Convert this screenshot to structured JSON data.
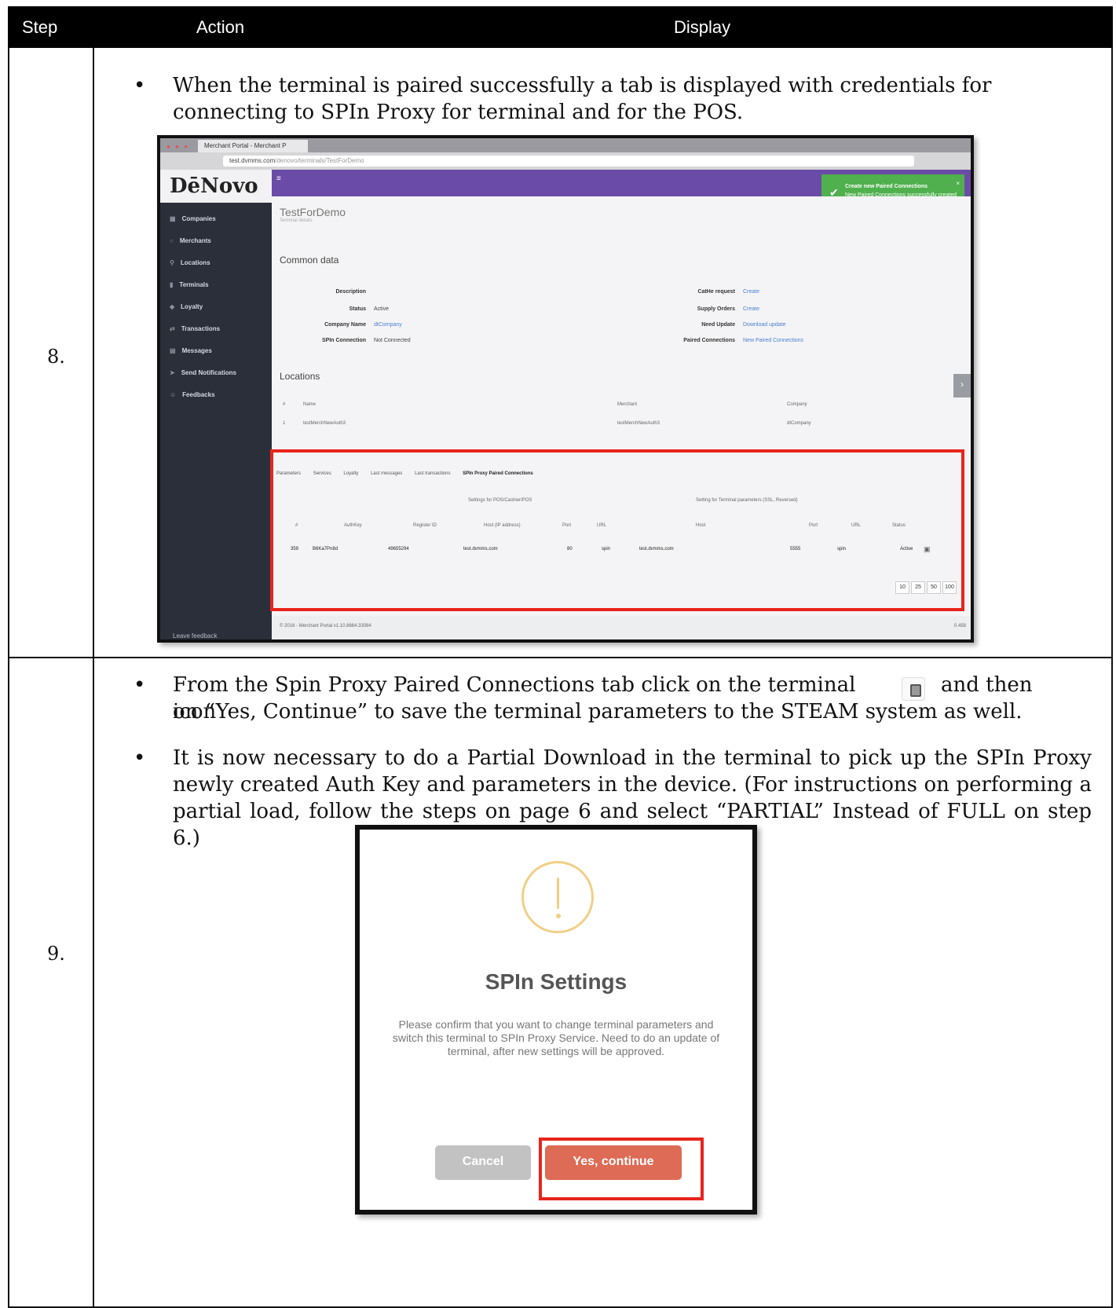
{
  "header": {
    "step": "Step",
    "action": "Action",
    "display": "Display"
  },
  "rows": [
    {
      "step": "8.",
      "bullets": [
        "When the terminal is paired successfully a tab is displayed with credentials for connecting to SPIn Proxy for terminal and for the POS."
      ]
    },
    {
      "step": "9.",
      "bullets": [
        "From the Spin Proxy Paired Connections tab click on the terminal icon",
        "and then on “Yes, Continue” to save the terminal parameters to the STEAM system as well.",
        "It is now necessary to do a Partial Download in the terminal to pick up the SPIn Proxy newly created Auth Key and parameters in the device. (For instructions on performing a partial load, follow the steps on page 6 and select “PARTIAL” Instead of FULL on step 6.)"
      ]
    }
  ],
  "screenshot": {
    "browser_tab": "Merchant Portal - Merchant P",
    "url_host": "test.dvmms.com",
    "url_path": "/denovo/terminals/TestForDemo",
    "logo": "DēNovo",
    "sidebar": [
      "Companies",
      "Merchants",
      "Locations",
      "Terminals",
      "Loyalty",
      "Transactions",
      "Messages",
      "Send Notifications",
      "Feedbacks"
    ],
    "leave_feedback": "Leave feedback",
    "toast_title": "Create new Paired Connections",
    "toast_body": "New Paired Connections successfully created",
    "page_title": "TestForDemo",
    "page_subtitle": "Terminal details",
    "common_data": "Common data",
    "fields": [
      {
        "label": "Description",
        "value": ""
      },
      {
        "label": "Status",
        "value": "Active"
      },
      {
        "label": "Company Name",
        "value": "dtCompany"
      },
      {
        "label": "SPIn Connection",
        "value": "Not Connected"
      }
    ],
    "right_fields": [
      {
        "label": "CatHe request",
        "value": "Create"
      },
      {
        "label": "Supply Orders",
        "value": "Create"
      },
      {
        "label": "Need Update",
        "value": "Download update"
      },
      {
        "label": "Paired Connections",
        "value": "New Paired Connections"
      }
    ],
    "locations": "Locations",
    "loc_headers": [
      "#",
      "Name",
      "Merchant",
      "Company"
    ],
    "loc_row": [
      "1",
      "testMerchNewAuth3",
      "testMerchNewAuth3",
      "dtCompany"
    ],
    "tabs": [
      "Parameters",
      "Services",
      "Loyalty",
      "Last messages",
      "Last transactions",
      "SPIn Proxy Paired Connections"
    ],
    "group_pos": "Settings for POS/Cashier/POS",
    "group_term": "Setting for Terminal parameters (SSL, Reversed)",
    "col_headers": [
      "#",
      "AuthKey",
      "Register ID",
      "Host (IP address)",
      "Port",
      "URL",
      "Host",
      "Port",
      "URL",
      "Status"
    ],
    "data_row": [
      "359",
      "B6Ka7Pn8d",
      "49655294",
      "test.dvmms.com",
      "80",
      "spin",
      "test.dvmms.com",
      "5555",
      "spin",
      "Active"
    ],
    "pager": [
      "10",
      "25",
      "50",
      "100"
    ],
    "footer": "© 2016 - Merchant Portal v1.10.8664.33084",
    "footer_right": "0.458"
  },
  "dialog": {
    "title": "SPIn Settings",
    "message": "Please confirm that you want to change terminal parameters and switch this terminal to SPIn Proxy Service. Need to do an update of terminal, after new settings will be approved.",
    "cancel": "Cancel",
    "confirm": "Yes, continue"
  },
  "colors": {
    "highlight": "#e8241c",
    "accent": "#6a4ba7",
    "confirm": "#dd6b55"
  }
}
